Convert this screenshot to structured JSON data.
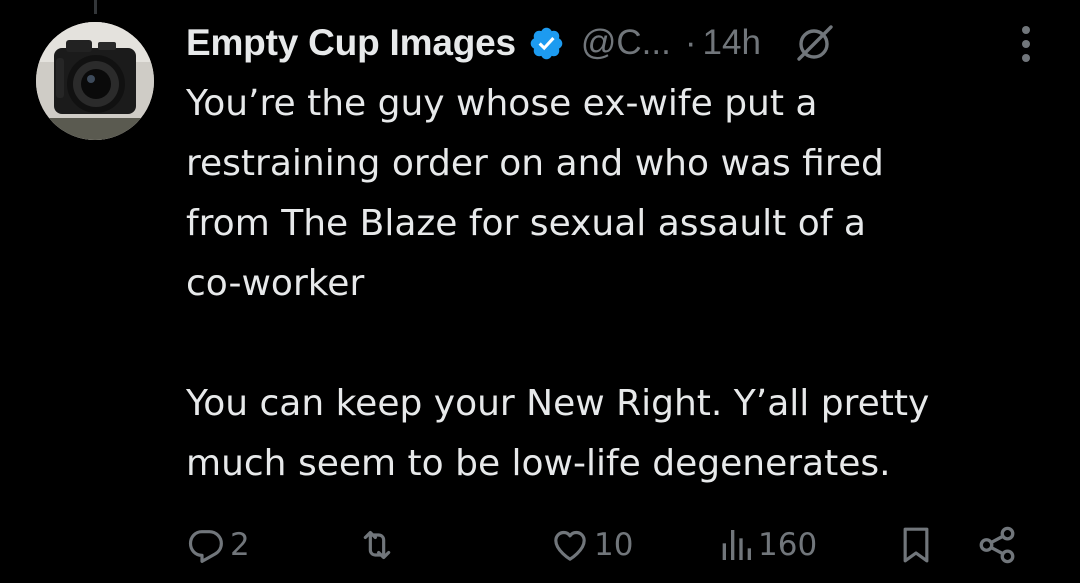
{
  "post": {
    "author_name": "Empty Cup Images",
    "handle": "@C...",
    "separator": "·",
    "timestamp": "14h",
    "paragraphs": [
      "You’re the guy whose ex-wife put a\nrestraining order on and who was fired\nfrom The Blaze for sexual assault of a\nco-worker",
      "You can keep your New Right. Y’all pretty\nmuch seem to be low-life degenerates."
    ]
  },
  "actions": {
    "replies": "2",
    "reposts": "",
    "likes": "10",
    "views": "160"
  },
  "icons": {
    "avatar": "camera-photo-avatar",
    "verified": "verified-badge-icon",
    "grok": "grok-icon",
    "more": "more-vertical-icon",
    "reply": "reply-icon",
    "repost": "repost-icon",
    "like": "heart-icon",
    "views": "views-chart-icon",
    "bookmark": "bookmark-icon",
    "share": "share-icon"
  },
  "colors": {
    "background": "#000000",
    "text_primary": "#e7e9ea",
    "text_secondary": "#71767b",
    "verified_blue": "#1d9bf0"
  }
}
